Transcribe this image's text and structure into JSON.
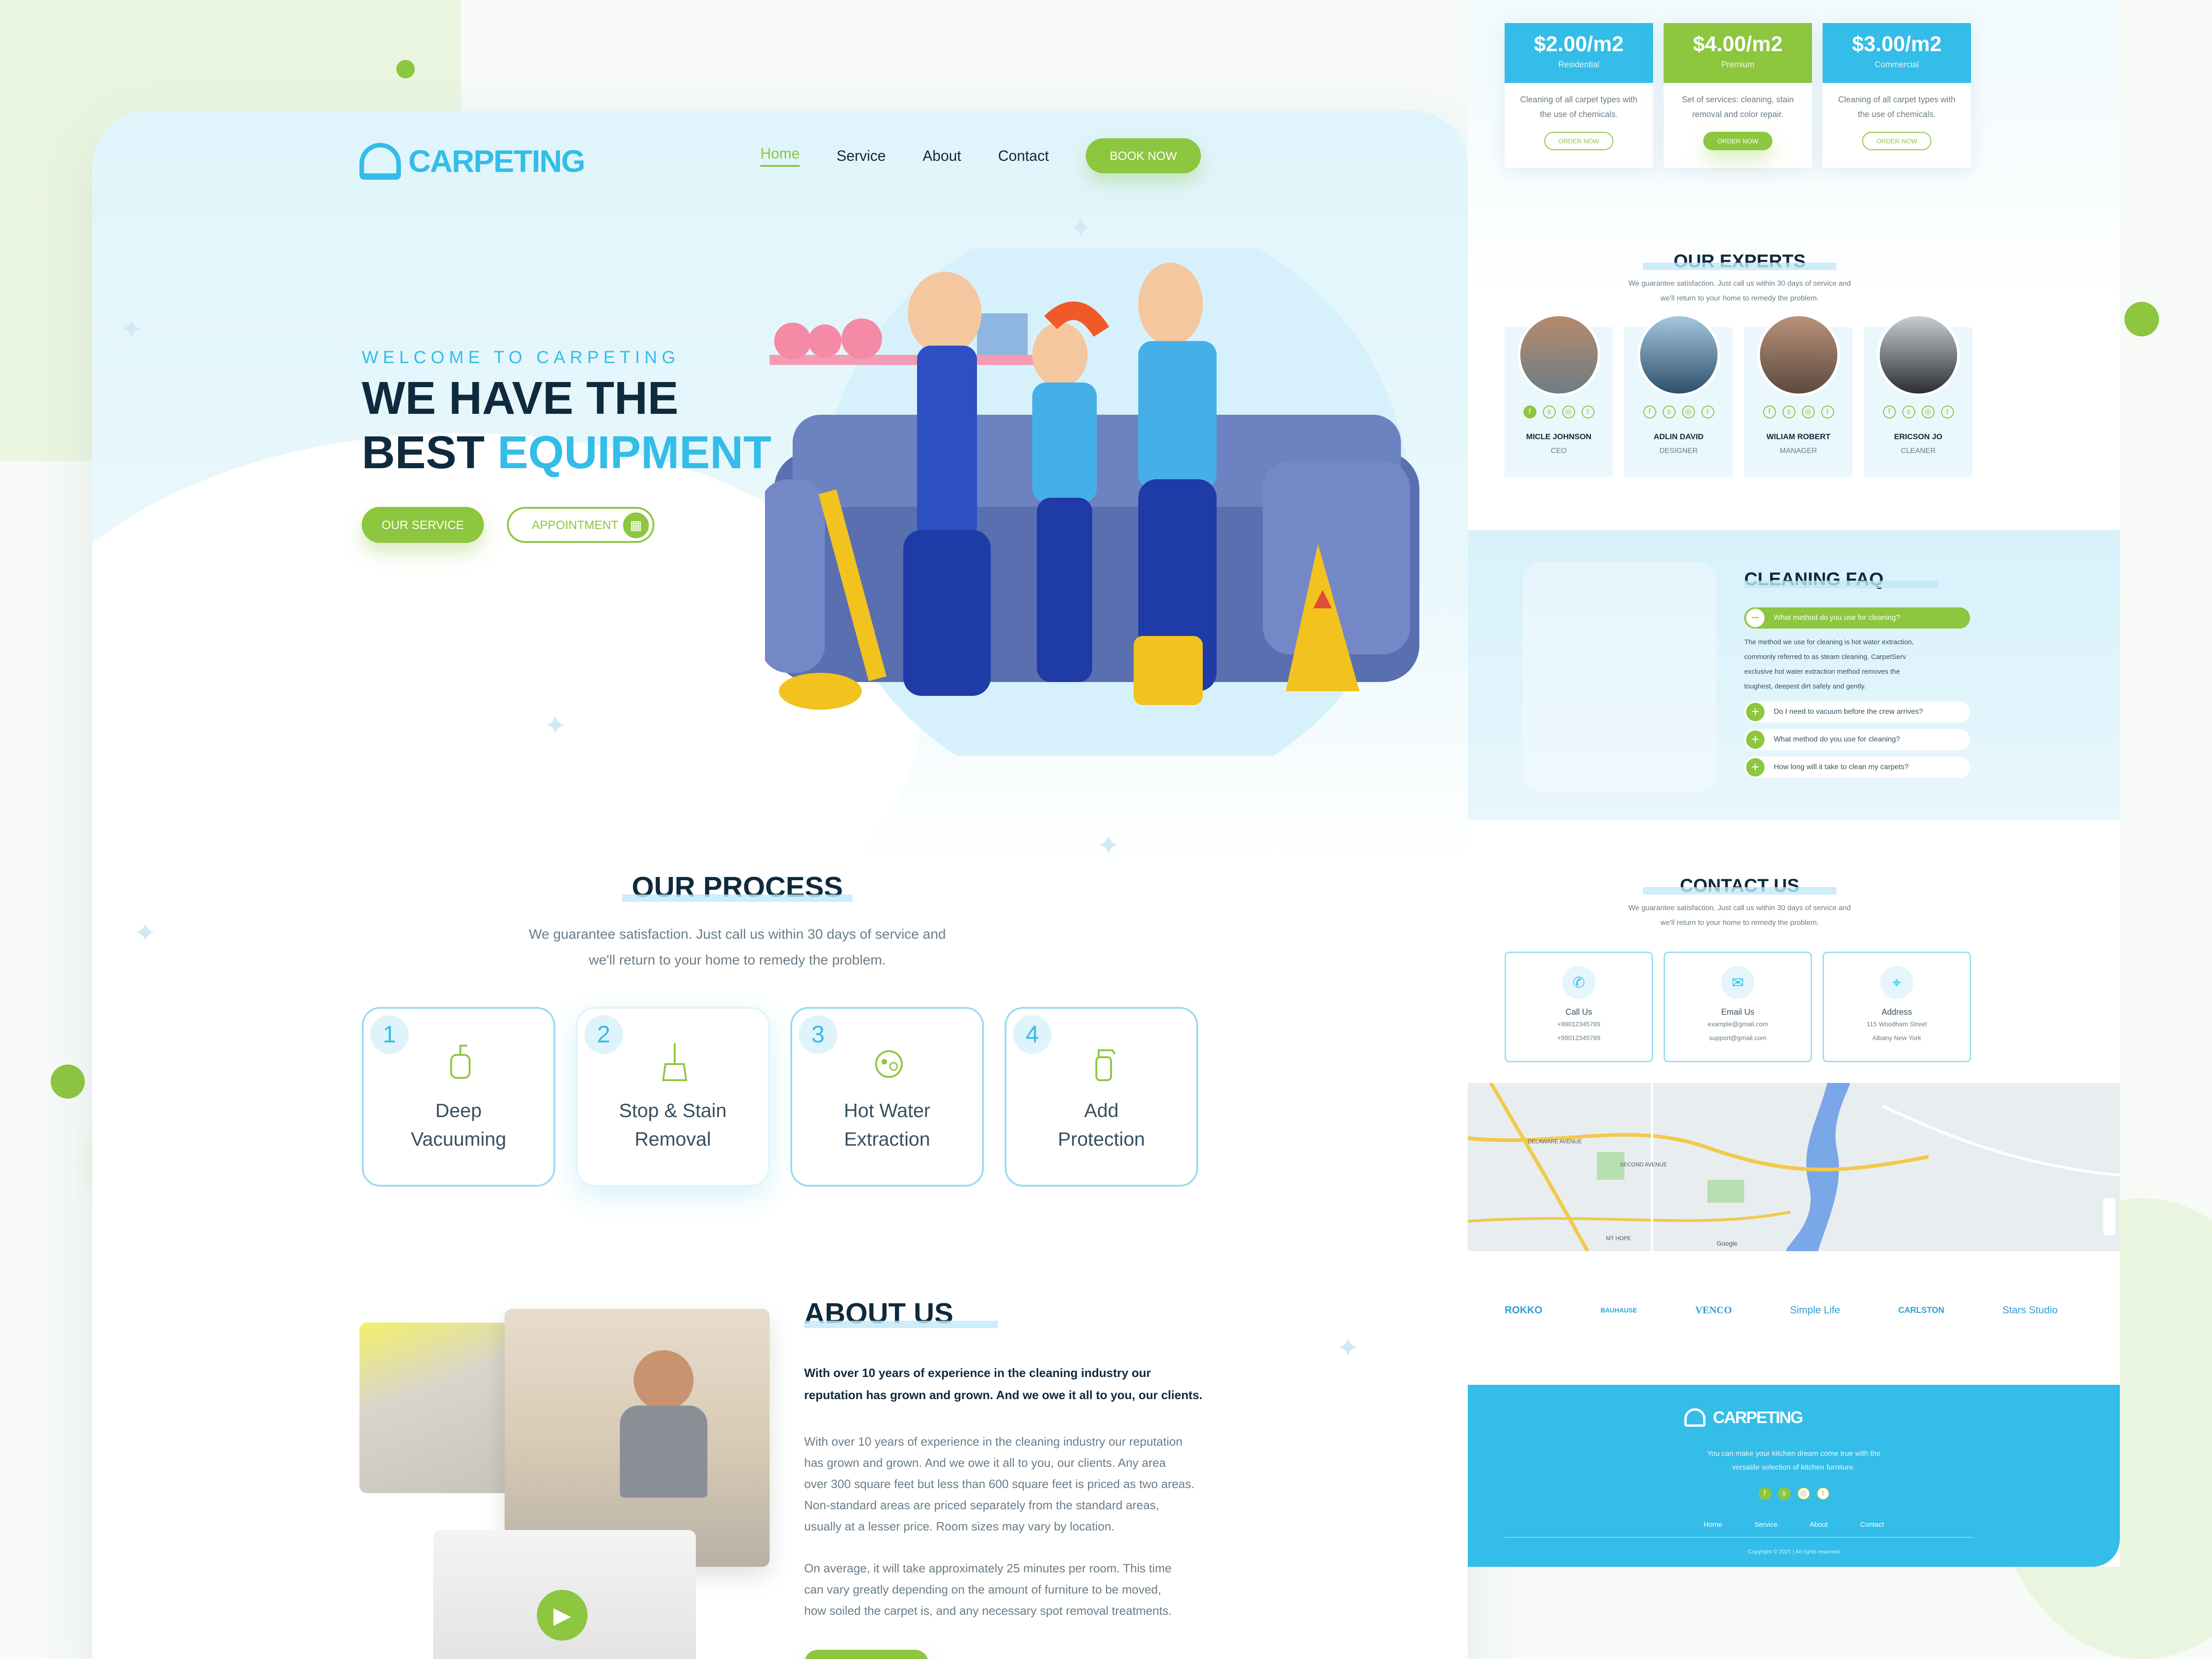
{
  "brand": {
    "name": "CARPETING"
  },
  "nav": {
    "items": [
      "Home",
      "Service",
      "About",
      "Contact"
    ],
    "book": "BOOK NOW"
  },
  "hero": {
    "eyebrow": "WELCOME TO CARPETING",
    "line1": "WE HAVE THE",
    "line2a": "BEST ",
    "line2b": "EQUIPMENT",
    "btn_service": "OUR SERVICE",
    "btn_appointment": "APPOINTMENT"
  },
  "process": {
    "title": "OUR PROCESS",
    "desc1": "We guarantee satisfaction. Just call us within 30 days of service and",
    "desc2": "we'll return to your home to remedy the problem.",
    "steps": [
      {
        "num": "1",
        "l1": "Deep",
        "l2": "Vacuuming"
      },
      {
        "num": "2",
        "l1": "Stop & Stain",
        "l2": "Removal"
      },
      {
        "num": "3",
        "l1": "Hot Water",
        "l2": "Extraction"
      },
      {
        "num": "4",
        "l1": "Add",
        "l2": "Protection"
      }
    ]
  },
  "about": {
    "title": "ABOUT US",
    "bold1": "With over 10 years of experience in the cleaning industry our",
    "bold2": "reputation has grown and grown. And we owe it all to you, our clients.",
    "p1": [
      "With over 10 years of experience in the cleaning industry our reputation",
      "has grown and grown. And we owe it all to you, our clients. Any area",
      "over 300 square feet but less than 600 square feet is priced as two areas.",
      "Non-standard areas are priced separately from the standard areas,",
      "usually at a lesser price. Room sizes may vary by location."
    ],
    "p2": [
      "On average, it will take approximately 25 minutes per room. This time",
      "can vary greatly depending on the amount of furniture to be moved,",
      "how soiled the carpet is, and any necessary spot removal treatments."
    ]
  },
  "pricing": [
    {
      "price": "$2.00/m2",
      "tier": "Residential",
      "d1": "Cleaning of all carpet types with",
      "d2": "the use of chemicals.",
      "btn": "ORDER NOW",
      "color": "#33bde8"
    },
    {
      "price": "$4.00/m2",
      "tier": "Premium",
      "d1": "Set of services: cleaning, stain",
      "d2": "removal and color repair.",
      "btn": "ORDER NOW",
      "color": "#8dc63f"
    },
    {
      "price": "$3.00/m2",
      "tier": "Commercial",
      "d1": "Cleaning of all carpet types with",
      "d2": "the use of chemicals.",
      "btn": "ORDER NOW",
      "color": "#33bde8"
    }
  ],
  "experts": {
    "title": "OUR EXPERTS",
    "desc1": "We guarantee satisfaction. Just call us within 30 days of service and",
    "desc2": "we'll return to your home to remedy the problem.",
    "people": [
      {
        "name": "MICLE JOHNSON",
        "role": "CEO"
      },
      {
        "name": "ADLIN DAVID",
        "role": "DESIGNER"
      },
      {
        "name": "WILIAM ROBERT",
        "role": "MANAGER"
      },
      {
        "name": "ERICSON JO",
        "role": "CLEANER"
      }
    ]
  },
  "faq": {
    "title": "CLEANING FAQ",
    "open_q": "What method do you use for cleaning?",
    "answer": [
      "The method we use for cleaning is hot water extraction,",
      "commonly referred to as steam cleaning. CarpetServ",
      "exclusive hot water extraction method removes the",
      "toughest, deepest dirt safely and gently."
    ],
    "questions": [
      "Do I need to vacuum before the crew arrives?",
      "What method do you use for cleaning?",
      "How long will it take to clean my carpets?"
    ]
  },
  "contact": {
    "title": "CONTACT US",
    "desc1": "We guarantee satisfaction. Just call us within 30 days of service and",
    "desc2": "we'll return to your home to remedy the problem.",
    "cards": [
      {
        "label": "Call Us",
        "v1": "+99012345789",
        "v2": "+99012345789"
      },
      {
        "label": "Email Us",
        "v1": "example@gmail.com",
        "v2": "support@gmail.com"
      },
      {
        "label": "Address",
        "v1": "115 Woodham Street",
        "v2": "Albany New York"
      }
    ]
  },
  "map": {
    "labels": [
      "DELAWARE AVENUE",
      "SECOND AVENUE",
      "MT HOPE",
      "Google"
    ]
  },
  "partners": [
    "ROKKO",
    "BAUHAUSE",
    "VENCO",
    "Simple Life",
    "CARLSTON",
    "Stars Studio"
  ],
  "footer": {
    "brand": "CARPETING",
    "t1": "You can make your kitchen dream come true with the",
    "t2": "versatile selection of kitchen furniture.",
    "links": [
      "Home",
      "Service",
      "About",
      "Contact"
    ],
    "copy": "Copyright © 2021 | All rights reserved"
  },
  "colors": {
    "green": "#8dc63f",
    "blue": "#33bde8",
    "navy": "#0f2a3d"
  },
  "icons": {
    "social": [
      "facebook-icon",
      "skype-icon",
      "instagram-icon",
      "twitter-icon"
    ],
    "calendar": "calendar-icon",
    "phone": "phone-icon",
    "mail": "mail-icon",
    "pin": "location-pin-icon",
    "play": "play-icon"
  }
}
